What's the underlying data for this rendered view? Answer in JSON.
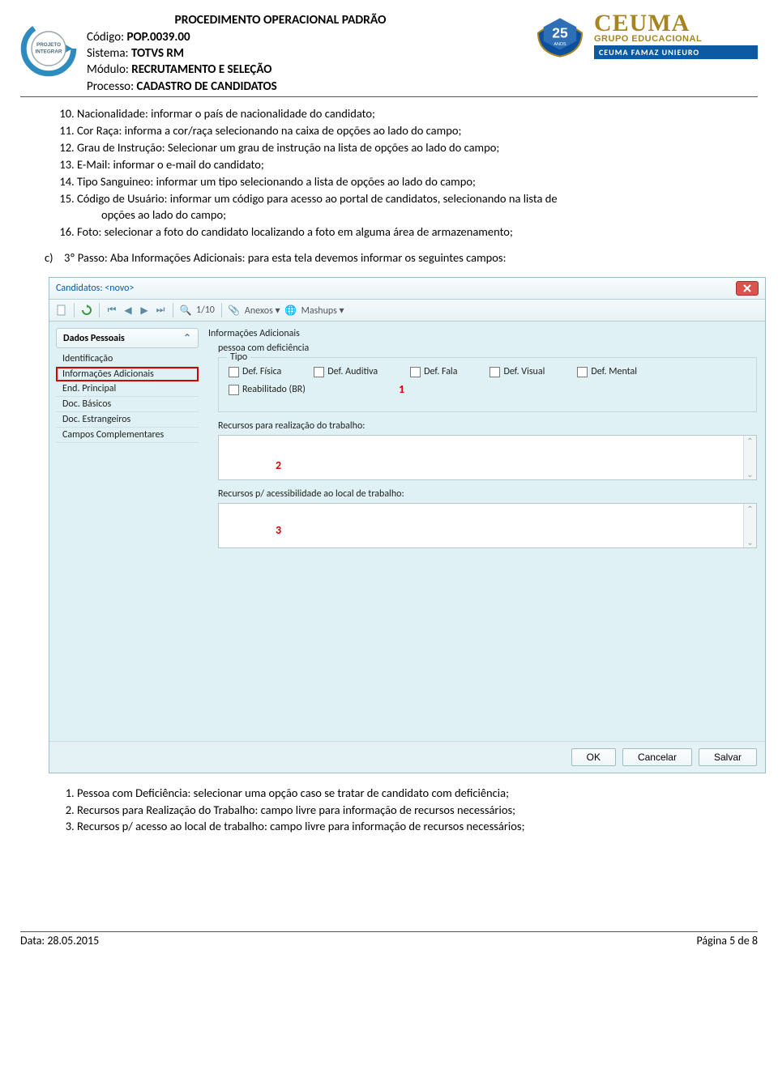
{
  "header": {
    "title": "PROCEDIMENTO OPERACIONAL PADRÃO",
    "code_label": "Código: ",
    "code_value": "POP.0039.00",
    "system_label": "Sistema: ",
    "system_value": "TOTVS RM",
    "module_label": "Módulo: ",
    "module_value": "RECRUTAMENTO E SELEÇÃO",
    "process_label": "Processo: ",
    "process_value": "CADASTRO DE CANDIDATOS",
    "logo_left_line1": "PROJETO",
    "logo_left_line2": "INTEGRAR",
    "badge25": "25",
    "badge25_sub": "ANOS",
    "ceuma": "CEUMA",
    "ceuma_sub": "GRUPO EDUCACIONAL",
    "ceuma_bar": "CEUMA FAMAZ UNIEURO"
  },
  "list1": {
    "i10": "Nacionalidade: informar o país de nacionalidade do candidato;",
    "i11": "Cor Raça: informa a cor/raça selecionando na caixa de opções ao lado do campo;",
    "i12": "Grau de Instrução: Selecionar um grau de instrução na lista de opções ao lado do campo;",
    "i13": "E-Mail: informar o e-mail do candidato;",
    "i14": "Tipo Sanguineo: informar um tipo selecionando a lista de opções ao lado do campo;",
    "i15a": "Código de Usuário: informar um código para acesso ao portal de candidatos, selecionando na lista de",
    "i15b": "opções ao lado do campo;",
    "i16": "Foto:  selecionar a foto do candidato localizando a foto em alguma área de armazenamento;"
  },
  "stepc": {
    "marker": "c)",
    "text": "3º Passo: Aba Informações Adicionais:  para esta tela devemos informar os seguintes campos:"
  },
  "win": {
    "title": "Candidatos: <novo>",
    "pager": "1/10",
    "anexos": "Anexos",
    "mashups": "Mashups",
    "sb_group": "Dados Pessoais",
    "sb_items": {
      "i0": "Identificação",
      "i1": "Informações Adicionais",
      "i2": "End. Principal",
      "i3": "Doc. Básicos",
      "i4": "Doc. Estrangeiros",
      "i5": "Campos Complementares"
    },
    "sect": "Informações Adicionais",
    "subsect": "pessoa com deficiência",
    "legend": "Tipo",
    "chk": {
      "c0": "Def. Física",
      "c1": "Def. Auditiva",
      "c2": "Def. Fala",
      "c3": "Def. Visual",
      "c4": "Def. Mental",
      "c5": "Reabilitado (BR)"
    },
    "num1": "1",
    "lbl2": "Recursos para realização do trabalho:",
    "num2": "2",
    "lbl3": "Recursos p/ acessibilidade ao local de trabalho:",
    "num3": "3",
    "btn_ok": "OK",
    "btn_cancel": "Cancelar",
    "btn_save": "Salvar"
  },
  "list2": {
    "n1": "Pessoa com Deficiência: selecionar uma opção caso se tratar de candidato com deficiência;",
    "n2": "Recursos para Realização do Trabalho: campo livre para informação de recursos necessários;",
    "n3": "Recursos p/ acesso ao local de trabalho: campo livre para informação de recursos necessários;"
  },
  "footer": {
    "date": "Data: 28.05.2015",
    "page": "Página 5 de 8"
  }
}
